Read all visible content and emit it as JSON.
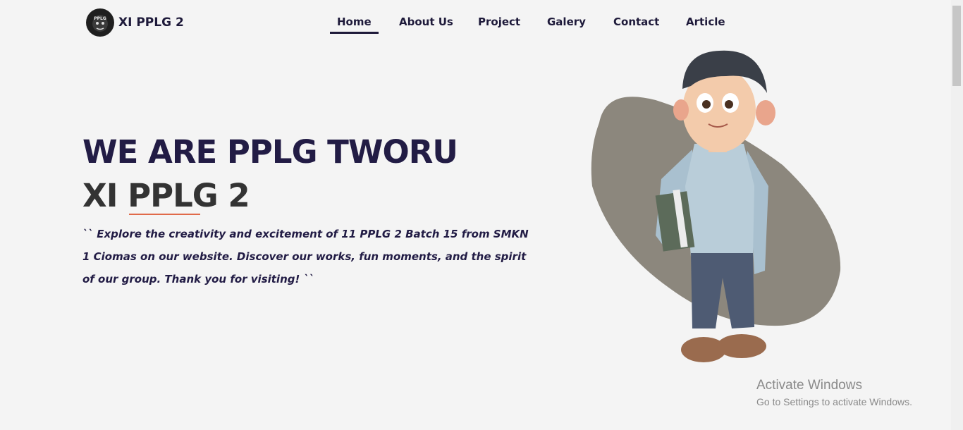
{
  "brand": {
    "name": "XI PPLG 2",
    "badge_text": "PPLG",
    "badge_icon": "gorilla-logo-icon"
  },
  "nav": {
    "items": [
      {
        "label": "Home",
        "active": true
      },
      {
        "label": "About Us",
        "active": false
      },
      {
        "label": "Project",
        "active": false
      },
      {
        "label": "Galery",
        "active": false
      },
      {
        "label": "Contact",
        "active": false
      },
      {
        "label": "Article",
        "active": false
      }
    ]
  },
  "hero": {
    "title": "WE ARE PPLG TWORU",
    "subtitle": "XI PPLG 2",
    "description": "`` Explore the creativity and excitement of 11 PPLG 2 Batch 15 from SMKN 1 Ciomas on our website. Discover our works, fun moments, and the spirit of our group. Thank you for visiting! ``",
    "illustration": "student-character-illustration",
    "accent_color": "#e06a4a"
  },
  "windows_watermark": {
    "title": "Activate Windows",
    "subtitle": "Go to Settings to activate Windows."
  }
}
